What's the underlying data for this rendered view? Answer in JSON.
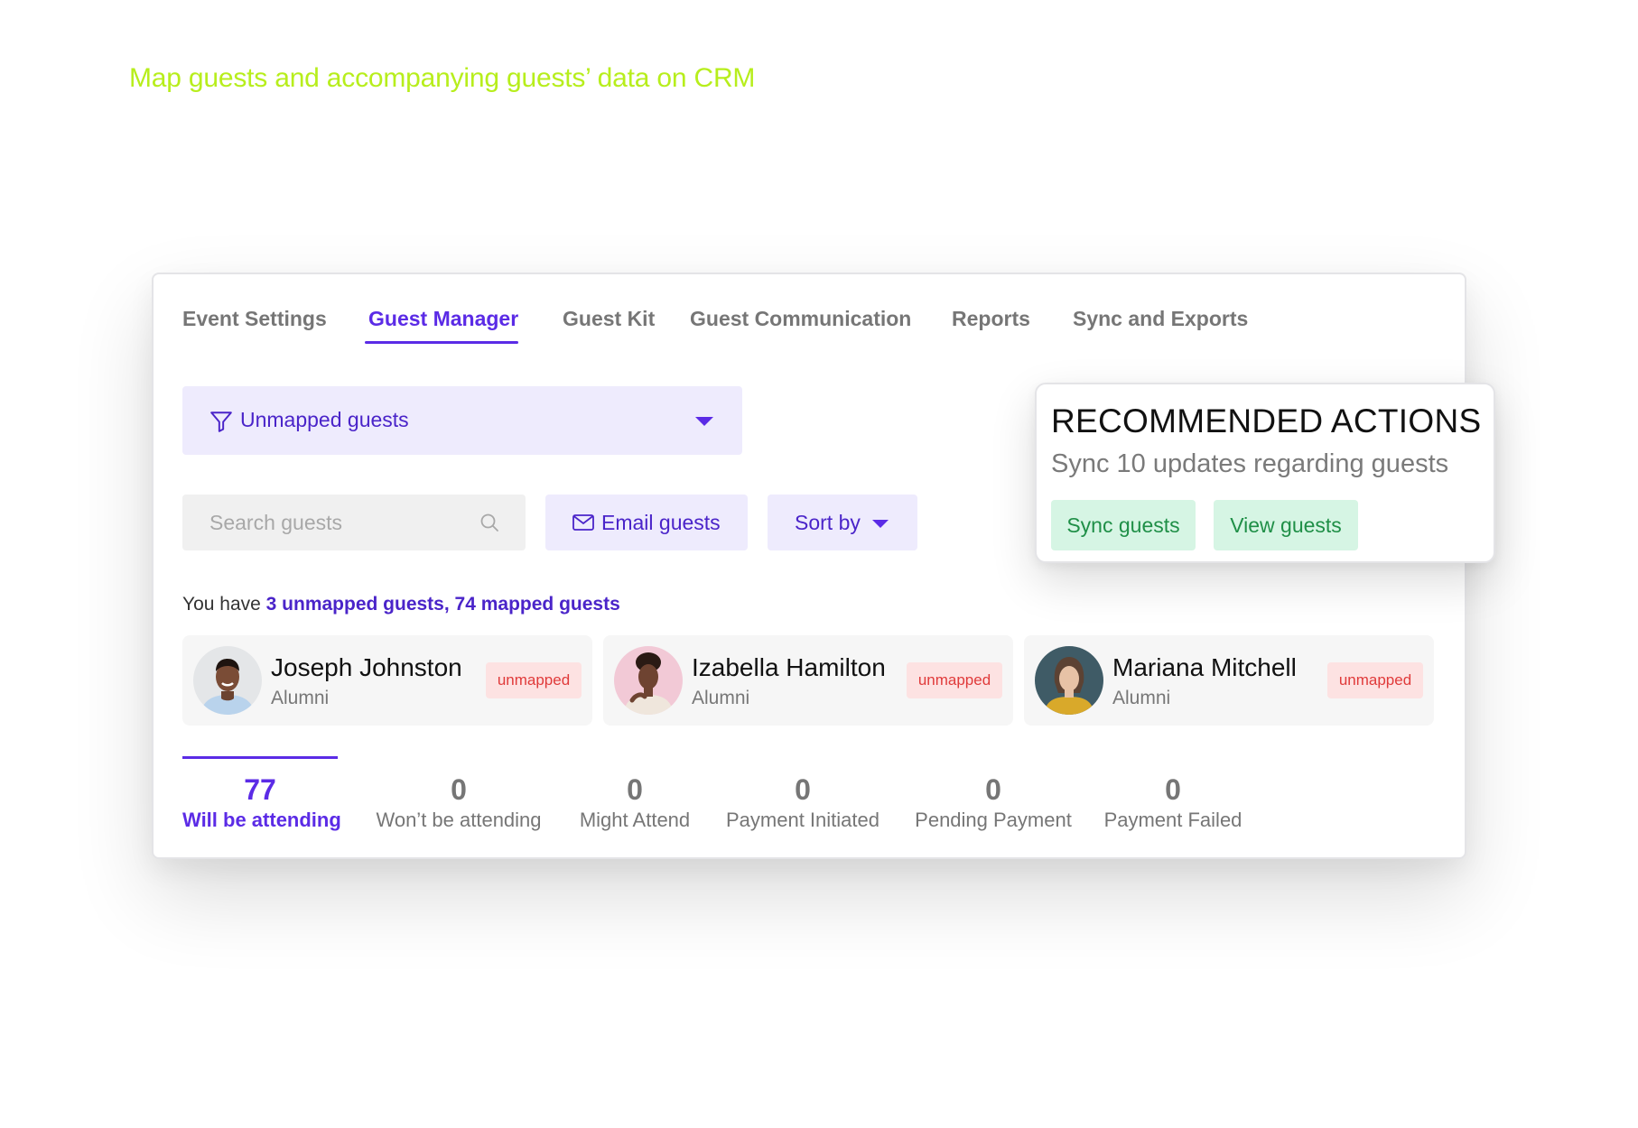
{
  "headline": "Map guests and accompanying guests’ data on CRM",
  "tabs": [
    {
      "label": "Event Settings",
      "active": false
    },
    {
      "label": "Guest Manager",
      "active": true
    },
    {
      "label": "Guest Kit",
      "active": false
    },
    {
      "label": "Guest Communication",
      "active": false
    },
    {
      "label": "Reports",
      "active": false
    },
    {
      "label": "Sync and Exports",
      "active": false
    }
  ],
  "filter": {
    "label": "Unmapped guests",
    "icon": "funnel-icon"
  },
  "search": {
    "placeholder": "Search guests",
    "icon": "search-icon"
  },
  "email_button": {
    "label": "Email guests",
    "icon": "envelope-icon"
  },
  "sort_button": {
    "label": "Sort by",
    "icon": "caret-down-icon"
  },
  "summary": {
    "prefix": "You have ",
    "unmapped": "3 unmapped guests",
    "separator": ", ",
    "mapped": "74 mapped guests"
  },
  "guests": [
    {
      "name": "Joseph Johnston",
      "role": "Alumni",
      "status": "unmapped"
    },
    {
      "name": "Izabella Hamilton",
      "role": "Alumni",
      "status": "unmapped"
    },
    {
      "name": "Mariana Mitchell",
      "role": "Alumni",
      "status": "unmapped"
    }
  ],
  "stats": [
    {
      "value": "77",
      "label": "Will be attending",
      "active": true
    },
    {
      "value": "0",
      "label": "Won’t be attending",
      "active": false
    },
    {
      "value": "0",
      "label": "Might Attend",
      "active": false
    },
    {
      "value": "0",
      "label": "Payment Initiated",
      "active": false
    },
    {
      "value": "0",
      "label": "Pending Payment",
      "active": false
    },
    {
      "value": "0",
      "label": "Payment Failed",
      "active": false
    }
  ],
  "recommended": {
    "title": "RECOMMENDED ACTIONS",
    "subtitle": "Sync 10 updates regarding guests",
    "sync_label": "Sync guests",
    "view_label": "View guests"
  },
  "colors": {
    "accent": "#5b2be6",
    "headline": "#b7ee1c",
    "badge_bg": "#fde2e2",
    "badge_text": "#e03a3a",
    "action_bg": "#d6f5e4",
    "action_text": "#1f8f47"
  }
}
